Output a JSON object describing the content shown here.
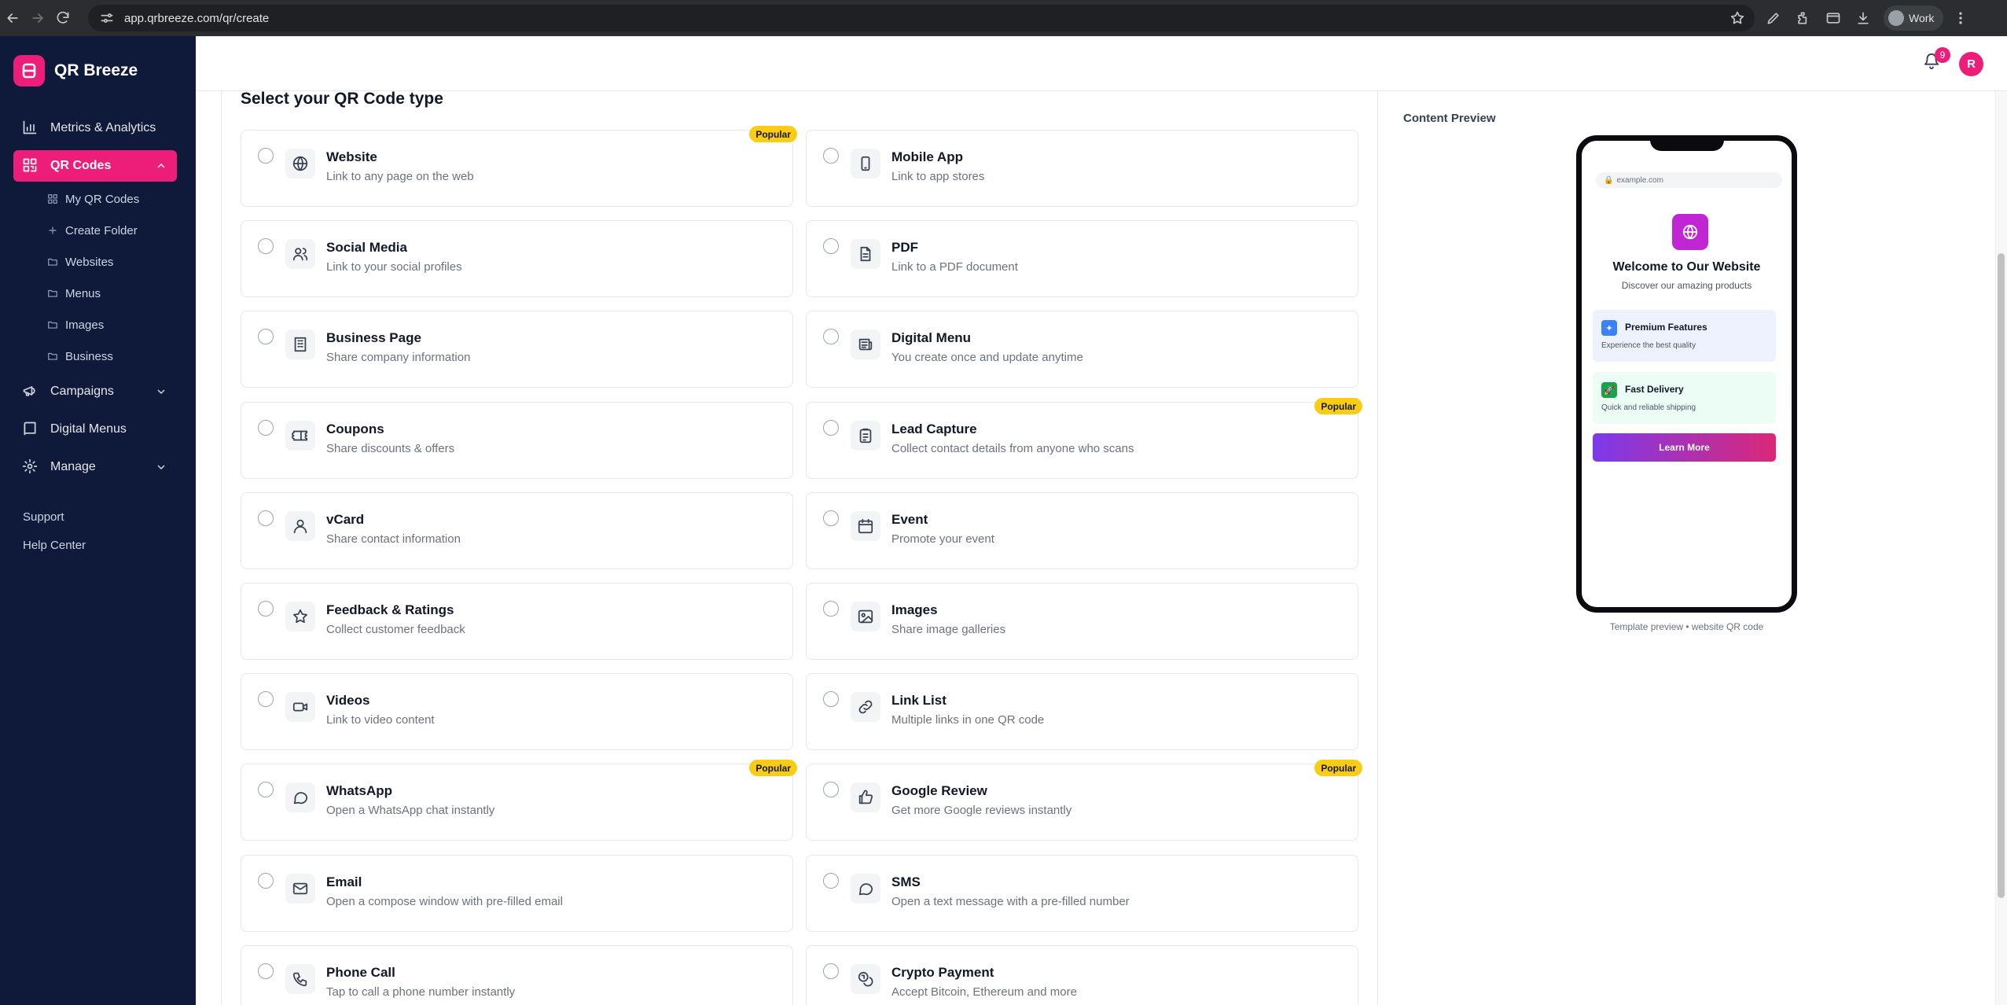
{
  "browser": {
    "url": "app.qrbreeze.com/qr/create",
    "profile_name": "Work"
  },
  "brand": {
    "name": "QR Breeze"
  },
  "sidebar": {
    "metrics": "Metrics & Analytics",
    "qr_codes": "QR Codes",
    "sub_items": [
      "My QR Codes",
      "Create Folder",
      "Websites",
      "Menus",
      "Images",
      "Business"
    ],
    "campaigns": "Campaigns",
    "digital_menus": "Digital Menus",
    "manage": "Manage",
    "support": "Support",
    "help_center": "Help Center"
  },
  "header": {
    "notification_count": "9",
    "avatar_initial": "R"
  },
  "main": {
    "title": "Select your QR Code type",
    "popular_label": "Popular",
    "types": [
      {
        "title": "Website",
        "desc": "Link to any page on the web",
        "icon": "globe-icon",
        "popular": true
      },
      {
        "title": "Mobile App",
        "desc": "Link to app stores",
        "icon": "smartphone-icon",
        "popular": false
      },
      {
        "title": "Social Media",
        "desc": "Link to your social profiles",
        "icon": "users-icon",
        "popular": false
      },
      {
        "title": "PDF",
        "desc": "Link to a PDF document",
        "icon": "file-text-icon",
        "popular": false
      },
      {
        "title": "Business Page",
        "desc": "Share company information",
        "icon": "building-icon",
        "popular": false
      },
      {
        "title": "Digital Menu",
        "desc": "You create once and update anytime",
        "icon": "newspaper-icon",
        "popular": false
      },
      {
        "title": "Coupons",
        "desc": "Share discounts & offers",
        "icon": "ticket-icon",
        "popular": false
      },
      {
        "title": "Lead Capture",
        "desc": "Collect contact details from anyone who scans",
        "icon": "clipboard-list-icon",
        "popular": true
      },
      {
        "title": "vCard",
        "desc": "Share contact information",
        "icon": "user-icon",
        "popular": false
      },
      {
        "title": "Event",
        "desc": "Promote your event",
        "icon": "calendar-icon",
        "popular": false
      },
      {
        "title": "Feedback & Ratings",
        "desc": "Collect customer feedback",
        "icon": "star-icon",
        "popular": false
      },
      {
        "title": "Images",
        "desc": "Share image galleries",
        "icon": "image-icon",
        "popular": false
      },
      {
        "title": "Videos",
        "desc": "Link to video content",
        "icon": "video-icon",
        "popular": false
      },
      {
        "title": "Link List",
        "desc": "Multiple links in one QR code",
        "icon": "link-icon",
        "popular": false
      },
      {
        "title": "WhatsApp",
        "desc": "Open a WhatsApp chat instantly",
        "icon": "message-circle-icon",
        "popular": true
      },
      {
        "title": "Google Review",
        "desc": "Get more Google reviews instantly",
        "icon": "thumbs-up-icon",
        "popular": true
      },
      {
        "title": "Email",
        "desc": "Open a compose window with pre-filled email",
        "icon": "mail-icon",
        "popular": false
      },
      {
        "title": "SMS",
        "desc": "Open a text message with a pre-filled number",
        "icon": "message-circle-icon",
        "popular": false
      },
      {
        "title": "Phone Call",
        "desc": "Tap to call a phone number instantly",
        "icon": "phone-icon",
        "popular": false
      },
      {
        "title": "Crypto Payment",
        "desc": "Accept Bitcoin, Ethereum and more",
        "icon": "coins-icon",
        "popular": false
      }
    ]
  },
  "preview": {
    "label": "Content Preview",
    "url": "example.com",
    "heading": "Welcome to Our Website",
    "subheading": "Discover our amazing products",
    "features": [
      {
        "title": "Premium Features",
        "desc": "Experience the best quality",
        "bg": "#eef2ff",
        "icon_bg": "#3b82f6",
        "icon_glyph": "✦"
      },
      {
        "title": "Fast Delivery",
        "desc": "Quick and reliable shipping",
        "bg": "#ecfdf5",
        "icon_bg": "#16a34a",
        "icon_glyph": "🚀"
      }
    ],
    "button": "Learn More",
    "caption": "Template preview • website QR code"
  },
  "colors": {
    "accent": "#ec1e79",
    "sidebar_bg": "#0f1a3a",
    "popular_badge": "#facc15"
  }
}
